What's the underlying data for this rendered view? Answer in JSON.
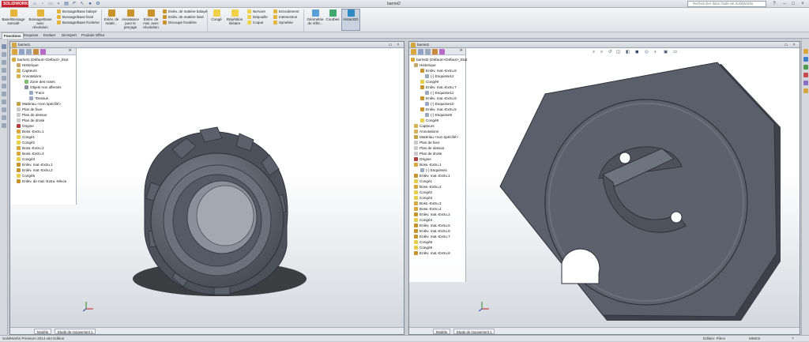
{
  "app": {
    "logo": "SOLIDWORKS",
    "title": "barriet2",
    "help_search_placeholder": "Rechercher dans l'aide de SolidWorks"
  },
  "ribbon": {
    "large_buttons": [
      {
        "label": "Base/Bossage extrudé",
        "icon": "extruded-boss-icon",
        "color": "#e3b53a"
      },
      {
        "label": "Bossage/Base avec révolution",
        "icon": "revolved-boss-icon",
        "color": "#e3b53a"
      },
      {
        "label": "Enlèv. de matér...",
        "icon": "extruded-cut-icon",
        "color": "#c9932c"
      },
      {
        "label": "Assistance pour le perçage",
        "icon": "hole-wizard-icon",
        "color": "#c9932c"
      },
      {
        "label": "Enlèv. de mat. avec révolution",
        "icon": "revolved-cut-icon",
        "color": "#c9932c"
      },
      {
        "label": "Congé",
        "icon": "fillet-icon",
        "color": "#f0d24a"
      },
      {
        "label": "Répétition linéaire",
        "icon": "linear-pattern-icon",
        "color": "#f0d24a"
      },
      {
        "label": "Géométrie de référ...",
        "icon": "reference-geometry-icon",
        "color": "#5aa0d8"
      },
      {
        "label": "Courbes",
        "icon": "curves-icon",
        "color": "#3fa86a"
      },
      {
        "label": "Instant3D",
        "icon": "instant3d-icon",
        "color": "#2f8ac4"
      }
    ],
    "small_buttons_col1": [
      {
        "label": "Bossage/Base balayé",
        "icon": "swept-boss-icon"
      },
      {
        "label": "Bossage/Base lissé",
        "icon": "lofted-boss-icon"
      },
      {
        "label": "Bossage/Base frontière",
        "icon": "boundary-boss-icon"
      }
    ],
    "small_buttons_col2": [
      {
        "label": "Enlèv. de matière balayé",
        "icon": "swept-cut-icon"
      },
      {
        "label": "Enlèv. de matière lissé",
        "icon": "lofted-cut-icon"
      },
      {
        "label": "Découpe frontière",
        "icon": "boundary-cut-icon"
      }
    ],
    "small_buttons_col3": [
      {
        "label": "Nervure",
        "icon": "rib-icon"
      },
      {
        "label": "Dépouille",
        "icon": "draft-icon"
      },
      {
        "label": "Coque",
        "icon": "shell-icon"
      }
    ],
    "small_buttons_col4": [
      {
        "label": "Enroulement",
        "icon": "wrap-icon"
      },
      {
        "label": "Intersection",
        "icon": "intersect-icon"
      },
      {
        "label": "Symétrie",
        "icon": "mirror-icon"
      }
    ]
  },
  "command_tabs": [
    "Fonctions",
    "Esquisse",
    "Evaluer",
    "DimXpert",
    "Produits Office"
  ],
  "left_doc": {
    "title": "barriet1",
    "tree": [
      "barriet1  (Défaut<<Défaut>_Etat",
      "Historique",
      "Capteurs",
      "Annotations",
      "Zone des notes",
      "Objets non affectés",
      "*Face",
      "*Dessus",
      "Matériau <non spécifié>",
      "Plan de face",
      "Plan de dessus",
      "Plan de droite",
      "Origine",
      "Boss.-Extru.1",
      "Congé1",
      "Congé2",
      "Boss.-Extru.2",
      "Boss.-Extru.3",
      "Congé3",
      "Enlèv. mat.-Extru.1",
      "Enlèv. mat.-Extru.2",
      "Congé5",
      "Enlèv. de mat.-Extru.-Mince"
    ],
    "tabs": [
      "Modèle",
      "Etude de mouvement 1"
    ]
  },
  "right_doc": {
    "title": "barriet2",
    "tree": [
      "barriet2  (Défaut<<Défaut>_Etat",
      "Historique",
      "Enlèv. mat.-Extru.8",
      "(-) Esquisse12",
      "Congé9",
      "Enlèv. mat.-Extru.7",
      "(-) Esquisse11",
      "Enlèv. mat.-Extru.6",
      "(-) Esquisse10",
      "Enlèv. mat.-Extru.5",
      "(-) Esquisse9",
      "Congé8",
      "Capteurs",
      "Annotations",
      "Matériau <non spécifié>",
      "Plan de face",
      "Plan de dessus",
      "Plan de droite",
      "Origine",
      "Boss.-Extru.1",
      "(-) Esquisse1",
      "Enlèv. mat.-Extru.1",
      "Congé1",
      "Boss.-Extru.2",
      "Congé2",
      "Congé3",
      "Boss.-Extru.3",
      "Boss.-Extru.4",
      "Enlèv. mat.-Extru.2",
      "Congé4",
      "Enlèv. mat.-Extru.5",
      "Enlèv. mat.-Extru.6",
      "Enlèv. mat.-Extru.7",
      "Congé8",
      "Congé9",
      "Enlèv. mat.-Extru.8"
    ],
    "tabs": [
      "Modèle",
      "Etude de mouvement 1"
    ]
  },
  "status": {
    "product": "SolidWorks Premium 2014 x64 Edition",
    "mode": "Edition: Pièce",
    "units": "MMGS"
  },
  "colors": {
    "part_body": "#5b5f6b",
    "part_edge": "#3a3d45",
    "accent": "#c8202a"
  }
}
